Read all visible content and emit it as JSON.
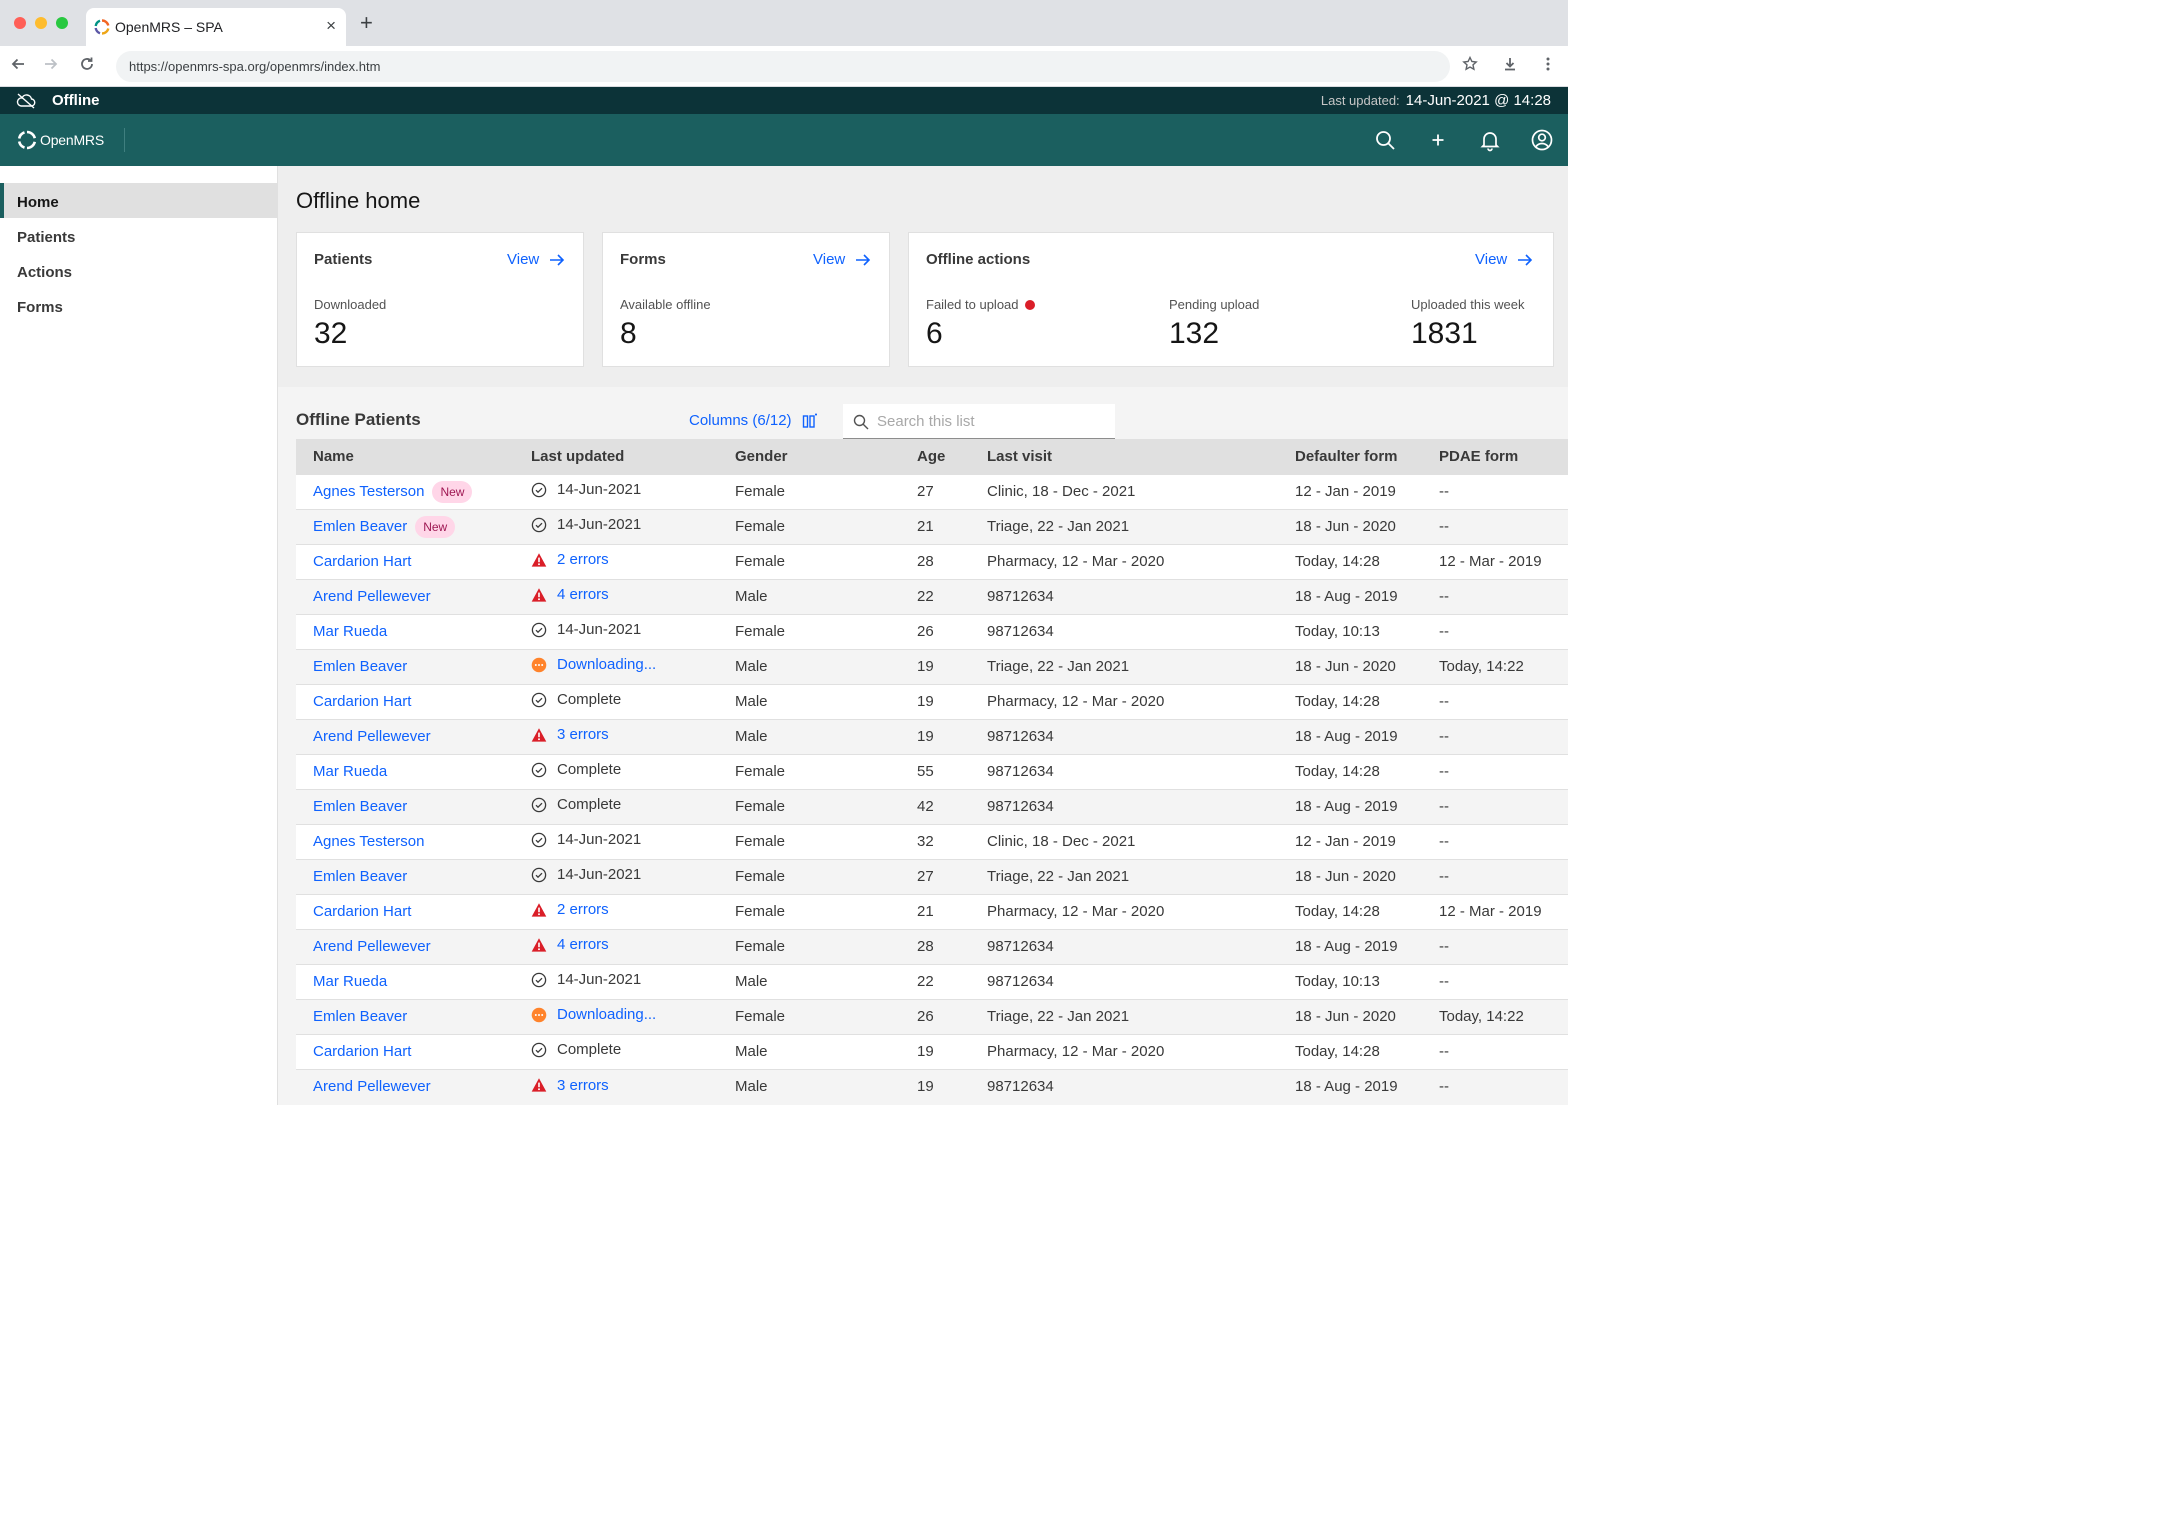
{
  "browser": {
    "tab_title": "OpenMRS – SPA",
    "tab_close": "×",
    "new_tab": "+",
    "url": "https://openmrs-spa.org/openmrs/index.htm",
    "colors": {
      "close": "#ff5f57",
      "minimize": "#febc2e",
      "maximize": "#28c840"
    }
  },
  "status_bar": {
    "label": "Offline",
    "last_updated_label": "Last updated:",
    "last_updated_value": "14-Jun-2021 @ 14:28"
  },
  "header": {
    "brand": "OpenMRS",
    "icons": [
      "search-icon",
      "add-icon",
      "notification-icon",
      "user-avatar-icon"
    ]
  },
  "sidenav": {
    "items": [
      {
        "label": "Home",
        "active": true
      },
      {
        "label": "Patients",
        "active": false
      },
      {
        "label": "Actions",
        "active": false
      },
      {
        "label": "Forms",
        "active": false
      }
    ]
  },
  "main": {
    "title": "Offline home",
    "cards": {
      "patients": {
        "title": "Patients",
        "link": "View",
        "metric_label": "Downloaded",
        "metric_value": "32"
      },
      "forms": {
        "title": "Forms",
        "link": "View",
        "metric_label": "Available offline",
        "metric_value": "8"
      },
      "actions": {
        "title": "Offline actions",
        "link": "View",
        "metrics": [
          {
            "label": "Failed to upload",
            "value": "6"
          },
          {
            "label": "Pending upload",
            "value": "132"
          },
          {
            "label": "Uploaded this week",
            "value": "1831"
          }
        ]
      }
    },
    "list": {
      "title": "Offline Patients",
      "columns_button": "Columns (6/12)",
      "search_placeholder": "Search this list",
      "headers": [
        "Name",
        "Last updated",
        "Gender",
        "Age",
        "Last visit",
        "Defaulter form",
        "PDAE form"
      ],
      "rows": [
        {
          "name": "Agnes Testerson",
          "badge": "New",
          "status": "ok",
          "last_updated": "14-Jun-2021",
          "gender": "Female",
          "age": "27",
          "last_visit": "Clinic, 18 - Dec - 2021",
          "defaulter": "12 - Jan - 2019",
          "pdae": "--"
        },
        {
          "name": "Emlen Beaver",
          "badge": "New",
          "status": "ok",
          "last_updated": "14-Jun-2021",
          "gender": "Female",
          "age": "21",
          "last_visit": "Triage, 22 - Jan 2021",
          "defaulter": "18 - Jun - 2020",
          "pdae": "--"
        },
        {
          "name": "Cardarion Hart",
          "badge": "",
          "status": "error",
          "last_updated": "2 errors",
          "gender": "Female",
          "age": "28",
          "last_visit": "Pharmacy, 12 - Mar - 2020",
          "defaulter": "Today, 14:28",
          "pdae": "12 - Mar - 2019"
        },
        {
          "name": "Arend Pellewever",
          "badge": "",
          "status": "error",
          "last_updated": "4 errors",
          "gender": "Male",
          "age": "22",
          "last_visit": "98712634",
          "defaulter": "18 - Aug - 2019",
          "pdae": "--"
        },
        {
          "name": "Mar Rueda",
          "badge": "",
          "status": "ok",
          "last_updated": "14-Jun-2021",
          "gender": "Female",
          "age": "26",
          "last_visit": "98712634",
          "defaulter": "Today, 10:13",
          "pdae": "--"
        },
        {
          "name": "Emlen Beaver",
          "badge": "",
          "status": "downloading",
          "last_updated": "Downloading...",
          "gender": "Male",
          "age": "19",
          "last_visit": "Triage, 22 - Jan 2021",
          "defaulter": "18 - Jun - 2020",
          "pdae": "Today, 14:22"
        },
        {
          "name": "Cardarion Hart",
          "badge": "",
          "status": "ok",
          "last_updated": "Complete",
          "gender": "Male",
          "age": "19",
          "last_visit": "Pharmacy, 12 - Mar - 2020",
          "defaulter": "Today, 14:28",
          "pdae": "--"
        },
        {
          "name": "Arend Pellewever",
          "badge": "",
          "status": "error",
          "last_updated": "3 errors",
          "gender": "Male",
          "age": "19",
          "last_visit": "98712634",
          "defaulter": "18 - Aug - 2019",
          "pdae": "--"
        },
        {
          "name": "Mar Rueda",
          "badge": "",
          "status": "ok",
          "last_updated": "Complete",
          "gender": "Female",
          "age": "55",
          "last_visit": "98712634",
          "defaulter": "Today, 14:28",
          "pdae": "--"
        },
        {
          "name": "Emlen Beaver",
          "badge": "",
          "status": "ok",
          "last_updated": "Complete",
          "gender": "Female",
          "age": "42",
          "last_visit": "98712634",
          "defaulter": "18 - Aug - 2019",
          "pdae": "--"
        },
        {
          "name": " Agnes Testerson",
          "badge": "",
          "status": "ok",
          "last_updated": "14-Jun-2021",
          "gender": "Female",
          "age": "32",
          "last_visit": "Clinic, 18 - Dec - 2021",
          "defaulter": "12 - Jan - 2019",
          "pdae": "--"
        },
        {
          "name": "Emlen Beaver",
          "badge": "",
          "status": "ok",
          "last_updated": "14-Jun-2021",
          "gender": "Female",
          "age": "27",
          "last_visit": "Triage, 22 - Jan 2021",
          "defaulter": "18 - Jun - 2020",
          "pdae": "--"
        },
        {
          "name": "Cardarion Hart",
          "badge": "",
          "status": "error",
          "last_updated": "2 errors",
          "gender": "Female",
          "age": "21",
          "last_visit": "Pharmacy, 12 - Mar - 2020",
          "defaulter": "Today, 14:28",
          "pdae": "12 - Mar - 2019"
        },
        {
          "name": "Arend Pellewever",
          "badge": "",
          "status": "error",
          "last_updated": "4 errors",
          "gender": "Female",
          "age": "28",
          "last_visit": "98712634",
          "defaulter": "18 - Aug - 2019",
          "pdae": "--"
        },
        {
          "name": "Mar Rueda",
          "badge": "",
          "status": "ok",
          "last_updated": "14-Jun-2021",
          "gender": "Male",
          "age": "22",
          "last_visit": "98712634",
          "defaulter": "Today, 10:13",
          "pdae": "--"
        },
        {
          "name": "Emlen Beaver",
          "badge": "",
          "status": "downloading",
          "last_updated": "Downloading...",
          "gender": "Female",
          "age": "26",
          "last_visit": "Triage, 22 - Jan 2021",
          "defaulter": "18 - Jun - 2020",
          "pdae": "Today, 14:22"
        },
        {
          "name": "Cardarion Hart",
          "badge": "",
          "status": "ok",
          "last_updated": "Complete",
          "gender": "Male",
          "age": "19",
          "last_visit": "Pharmacy, 12 - Mar - 2020",
          "defaulter": "Today, 14:28",
          "pdae": "--"
        },
        {
          "name": "Arend Pellewever",
          "badge": "",
          "status": "error",
          "last_updated": "3 errors",
          "gender": "Male",
          "age": "19",
          "last_visit": "98712634",
          "defaulter": "18 - Aug - 2019",
          "pdae": "--"
        }
      ]
    }
  },
  "colors": {
    "header": "#1b5f5f",
    "offline_bar": "#0c3338",
    "link": "#0f62fe",
    "error": "#da1e28",
    "downloading": "#ff832b",
    "badge_bg": "#ffd6e8"
  }
}
